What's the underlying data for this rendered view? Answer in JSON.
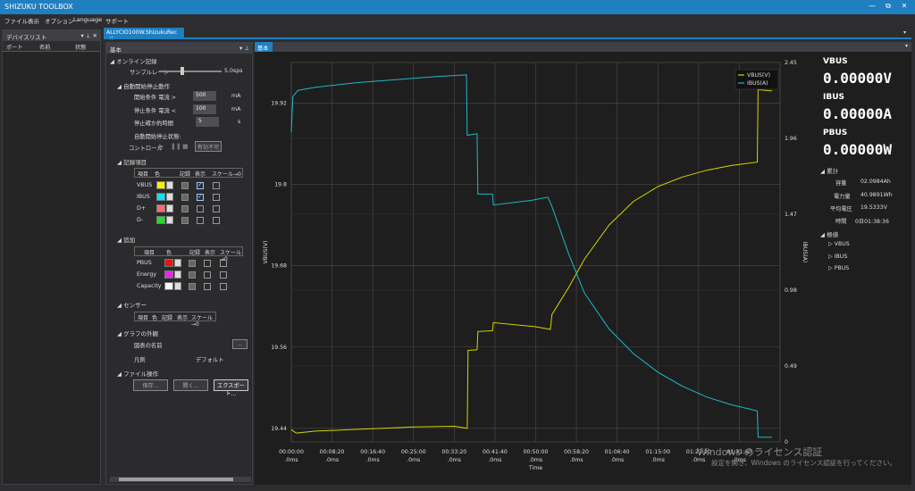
{
  "app": {
    "title": "SHIZUKU TOOLBOX",
    "min": "—",
    "max": "⧉",
    "close": "✕"
  },
  "menu": [
    "ファイル",
    "表示",
    "オプション",
    "Language",
    "サポート"
  ],
  "device_panel": {
    "title": "デバイスリスト",
    "cols": [
      "ポート",
      "名前",
      "状態"
    ],
    "pin": "▾ ⊥ ✕"
  },
  "doc_tab": {
    "label": "ALLYCIO100W.ShizukuRec",
    "close": "✕"
  },
  "settings": {
    "title": "基本",
    "online": {
      "header": "オンライン記録",
      "sample_rate_label": "サンプルレート",
      "sample_rate_value": "5.0sps"
    },
    "auto": {
      "header": "自動開始停止動作",
      "start_label": "開始条件 電流 >",
      "start_value": "500",
      "start_unit": "mA",
      "stop_label": "停止条件 電流 <",
      "stop_value": "100",
      "stop_unit": "mA",
      "confirm_label": "停止確か約時間",
      "confirm_value": "5",
      "confirm_unit": "s",
      "status_label": "自動開始停止状態:",
      "control_label": "コントロール",
      "disabled_button": "有効不可"
    },
    "record": {
      "header": "記録項目",
      "cols": [
        "項目",
        "色",
        "記録",
        "表示",
        "スケール→0"
      ],
      "rows": [
        {
          "name": "VBUS",
          "color": "#ffee00"
        },
        {
          "name": "IBUS",
          "color": "#00e5ff"
        },
        {
          "name": "D+",
          "color": "#ff6b6b"
        },
        {
          "name": "D-",
          "color": "#22dd22"
        }
      ]
    },
    "add": {
      "header": "追加",
      "cols": [
        "項目",
        "色",
        "記録",
        "表示",
        "スケール→0"
      ],
      "rows": [
        {
          "name": "PBUS",
          "color": "#ee1111"
        },
        {
          "name": "Energy",
          "color": "#ee22ee"
        },
        {
          "name": "Capacity",
          "color": "#ffffff"
        }
      ]
    },
    "sensor": {
      "header": "センサー",
      "cols": [
        "項目",
        "色",
        "記録",
        "表示",
        "スケール→0"
      ]
    },
    "appearance": {
      "header": "グラフの外観",
      "chart_name_label": "図表の名前",
      "legend_label": "凡例",
      "legend_value": "デフォルト"
    },
    "file": {
      "header": "ファイル操作",
      "save": "保存...",
      "open": "開く...",
      "export": "エクスポート..."
    }
  },
  "chart_panel": {
    "tab": "基本"
  },
  "readout": {
    "vbus_label": "VBUS",
    "vbus_value": "0.00000V",
    "ibus_label": "IBUS",
    "ibus_value": "0.00000A",
    "pbus_label": "PBUS",
    "pbus_value": "0.00000W",
    "cumulative_header": "累計",
    "capacity_label": "容量",
    "capacity_value": "02.0984Ah",
    "energy_label": "電力量",
    "energy_value": "40.9891Wh",
    "avg_v_label": "平均電圧",
    "avg_v_value": "19.5333V",
    "time_label": "時間",
    "time_value": "0日01:38:36",
    "extreme_header": "極値",
    "extreme_items": [
      "VBUS",
      "IBUS",
      "PBUS"
    ]
  },
  "watermark": {
    "line1": "Windows のライセンス認証",
    "line2": "設定を開き、Windows のライセンス認証を行ってください。"
  },
  "chart_data": {
    "type": "line",
    "xlabel": "Time",
    "ylabel_left": "VBUS(V)",
    "ylabel_right": "IBUS(A)",
    "x_ticks": [
      "00:00:00",
      "00:08:20",
      "00:16:40",
      "00:25:00",
      "00:33:20",
      "00:41:40",
      "00:50:00",
      "00:58:20",
      "01:06:40",
      "01:15:00",
      "01:23:20",
      "01:31:40"
    ],
    "x_tick_sub": ".0ms",
    "xlim_seconds": [
      0,
      6000
    ],
    "ylim_left": [
      19.42,
      19.98
    ],
    "ylim_right": [
      0,
      2.45
    ],
    "y_ticks_left": [
      "19.92",
      "19.8",
      "19.68",
      "19.56",
      "19.44"
    ],
    "y_ticks_right": [
      "2.45",
      "1.96",
      "1.47",
      "0.98",
      "0.49",
      "0"
    ],
    "grid": true,
    "legend_position": "top-right",
    "series": [
      {
        "name": "VBUS(V)",
        "color": "#d4d400",
        "axis": "left",
        "points": [
          [
            0,
            19.438
          ],
          [
            60,
            19.433
          ],
          [
            300,
            19.436
          ],
          [
            900,
            19.439
          ],
          [
            1500,
            19.442
          ],
          [
            2000,
            19.443
          ],
          [
            2160,
            19.44
          ],
          [
            2170,
            19.555
          ],
          [
            2280,
            19.556
          ],
          [
            2290,
            19.583
          ],
          [
            2470,
            19.584
          ],
          [
            2480,
            19.596
          ],
          [
            3000,
            19.59
          ],
          [
            3180,
            19.586
          ],
          [
            3200,
            19.608
          ],
          [
            3400,
            19.647
          ],
          [
            3600,
            19.69
          ],
          [
            3900,
            19.74
          ],
          [
            4200,
            19.775
          ],
          [
            4500,
            19.797
          ],
          [
            4800,
            19.811
          ],
          [
            5100,
            19.821
          ],
          [
            5400,
            19.828
          ],
          [
            5720,
            19.833
          ],
          [
            5730,
            19.94
          ],
          [
            5900,
            19.938
          ]
        ]
      },
      {
        "name": "IBUS(A)",
        "color": "#1fb8c8",
        "axis": "right",
        "points": [
          [
            0,
            2.0
          ],
          [
            20,
            2.23
          ],
          [
            80,
            2.27
          ],
          [
            300,
            2.29
          ],
          [
            800,
            2.32
          ],
          [
            1300,
            2.34
          ],
          [
            1800,
            2.36
          ],
          [
            2150,
            2.37
          ],
          [
            2160,
            1.98
          ],
          [
            2280,
            1.99
          ],
          [
            2290,
            1.6
          ],
          [
            2470,
            1.6
          ],
          [
            2480,
            1.53
          ],
          [
            2950,
            1.56
          ],
          [
            3150,
            1.58
          ],
          [
            3200,
            1.52
          ],
          [
            3400,
            1.22
          ],
          [
            3600,
            0.96
          ],
          [
            3900,
            0.73
          ],
          [
            4200,
            0.57
          ],
          [
            4500,
            0.45
          ],
          [
            4800,
            0.36
          ],
          [
            5100,
            0.29
          ],
          [
            5400,
            0.24
          ],
          [
            5720,
            0.2
          ],
          [
            5730,
            0.03
          ],
          [
            5900,
            0.03
          ]
        ]
      }
    ]
  }
}
